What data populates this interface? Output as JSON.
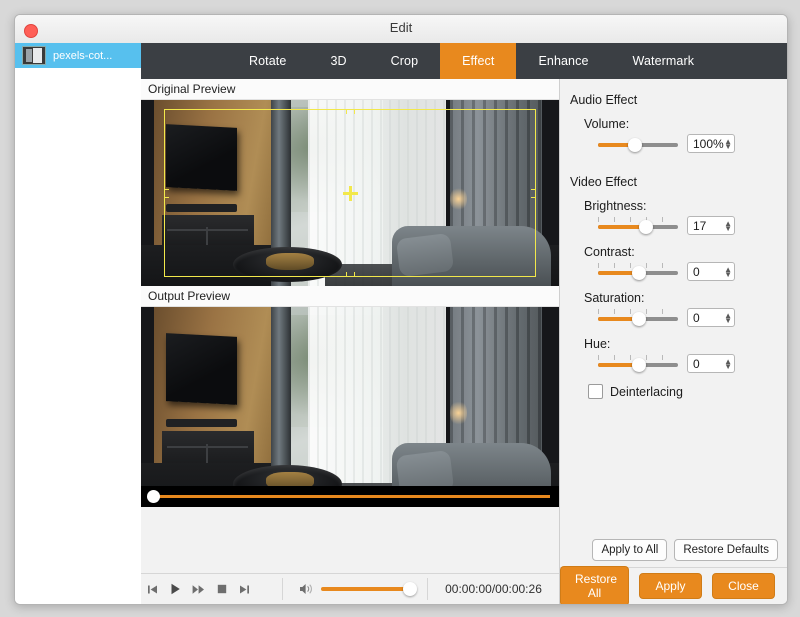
{
  "window": {
    "title": "Edit",
    "close_button": "close"
  },
  "sidebar": {
    "items": [
      {
        "name": "pexels-cot...",
        "thumb": "video-thumbnail"
      }
    ]
  },
  "tabs": [
    {
      "label": "Rotate",
      "active": false
    },
    {
      "label": "3D",
      "active": false
    },
    {
      "label": "Crop",
      "active": false
    },
    {
      "label": "Effect",
      "active": true
    },
    {
      "label": "Enhance",
      "active": false
    },
    {
      "label": "Watermark",
      "active": false
    }
  ],
  "previews": {
    "original_label": "Original Preview",
    "output_label": "Output Preview"
  },
  "transport": {
    "buttons": [
      "skip-start",
      "play",
      "fast-forward",
      "stop",
      "skip-end"
    ],
    "volume_icon": "speaker-icon",
    "volume_level": 100,
    "timecode": "00:00:00/00:00:26",
    "seek_position": 0
  },
  "panel": {
    "audio_effect_title": "Audio Effect",
    "video_effect_title": "Video Effect",
    "volume": {
      "label": "Volume:",
      "value": "100%",
      "fill_percent": 43,
      "ticks": false
    },
    "brightness": {
      "label": "Brightness:",
      "value": "17",
      "fill_percent": 57,
      "ticks": true
    },
    "contrast": {
      "label": "Contrast:",
      "value": "0",
      "fill_percent": 50,
      "ticks": true
    },
    "saturation": {
      "label": "Saturation:",
      "value": "0",
      "fill_percent": 50,
      "ticks": true
    },
    "hue": {
      "label": "Hue:",
      "value": "0",
      "fill_percent": 50,
      "ticks": true
    },
    "deinterlacing": {
      "label": "Deinterlacing",
      "checked": false
    },
    "apply_to_all": "Apply to All",
    "restore_defaults": "Restore Defaults"
  },
  "footer": {
    "restore_all": "Restore All",
    "apply": "Apply",
    "close": "Close"
  },
  "colors": {
    "accent": "#e8891e",
    "tabbar": "#3b3f44",
    "selection": "#57c0ee",
    "crop_overlay": "#f2e84b"
  }
}
